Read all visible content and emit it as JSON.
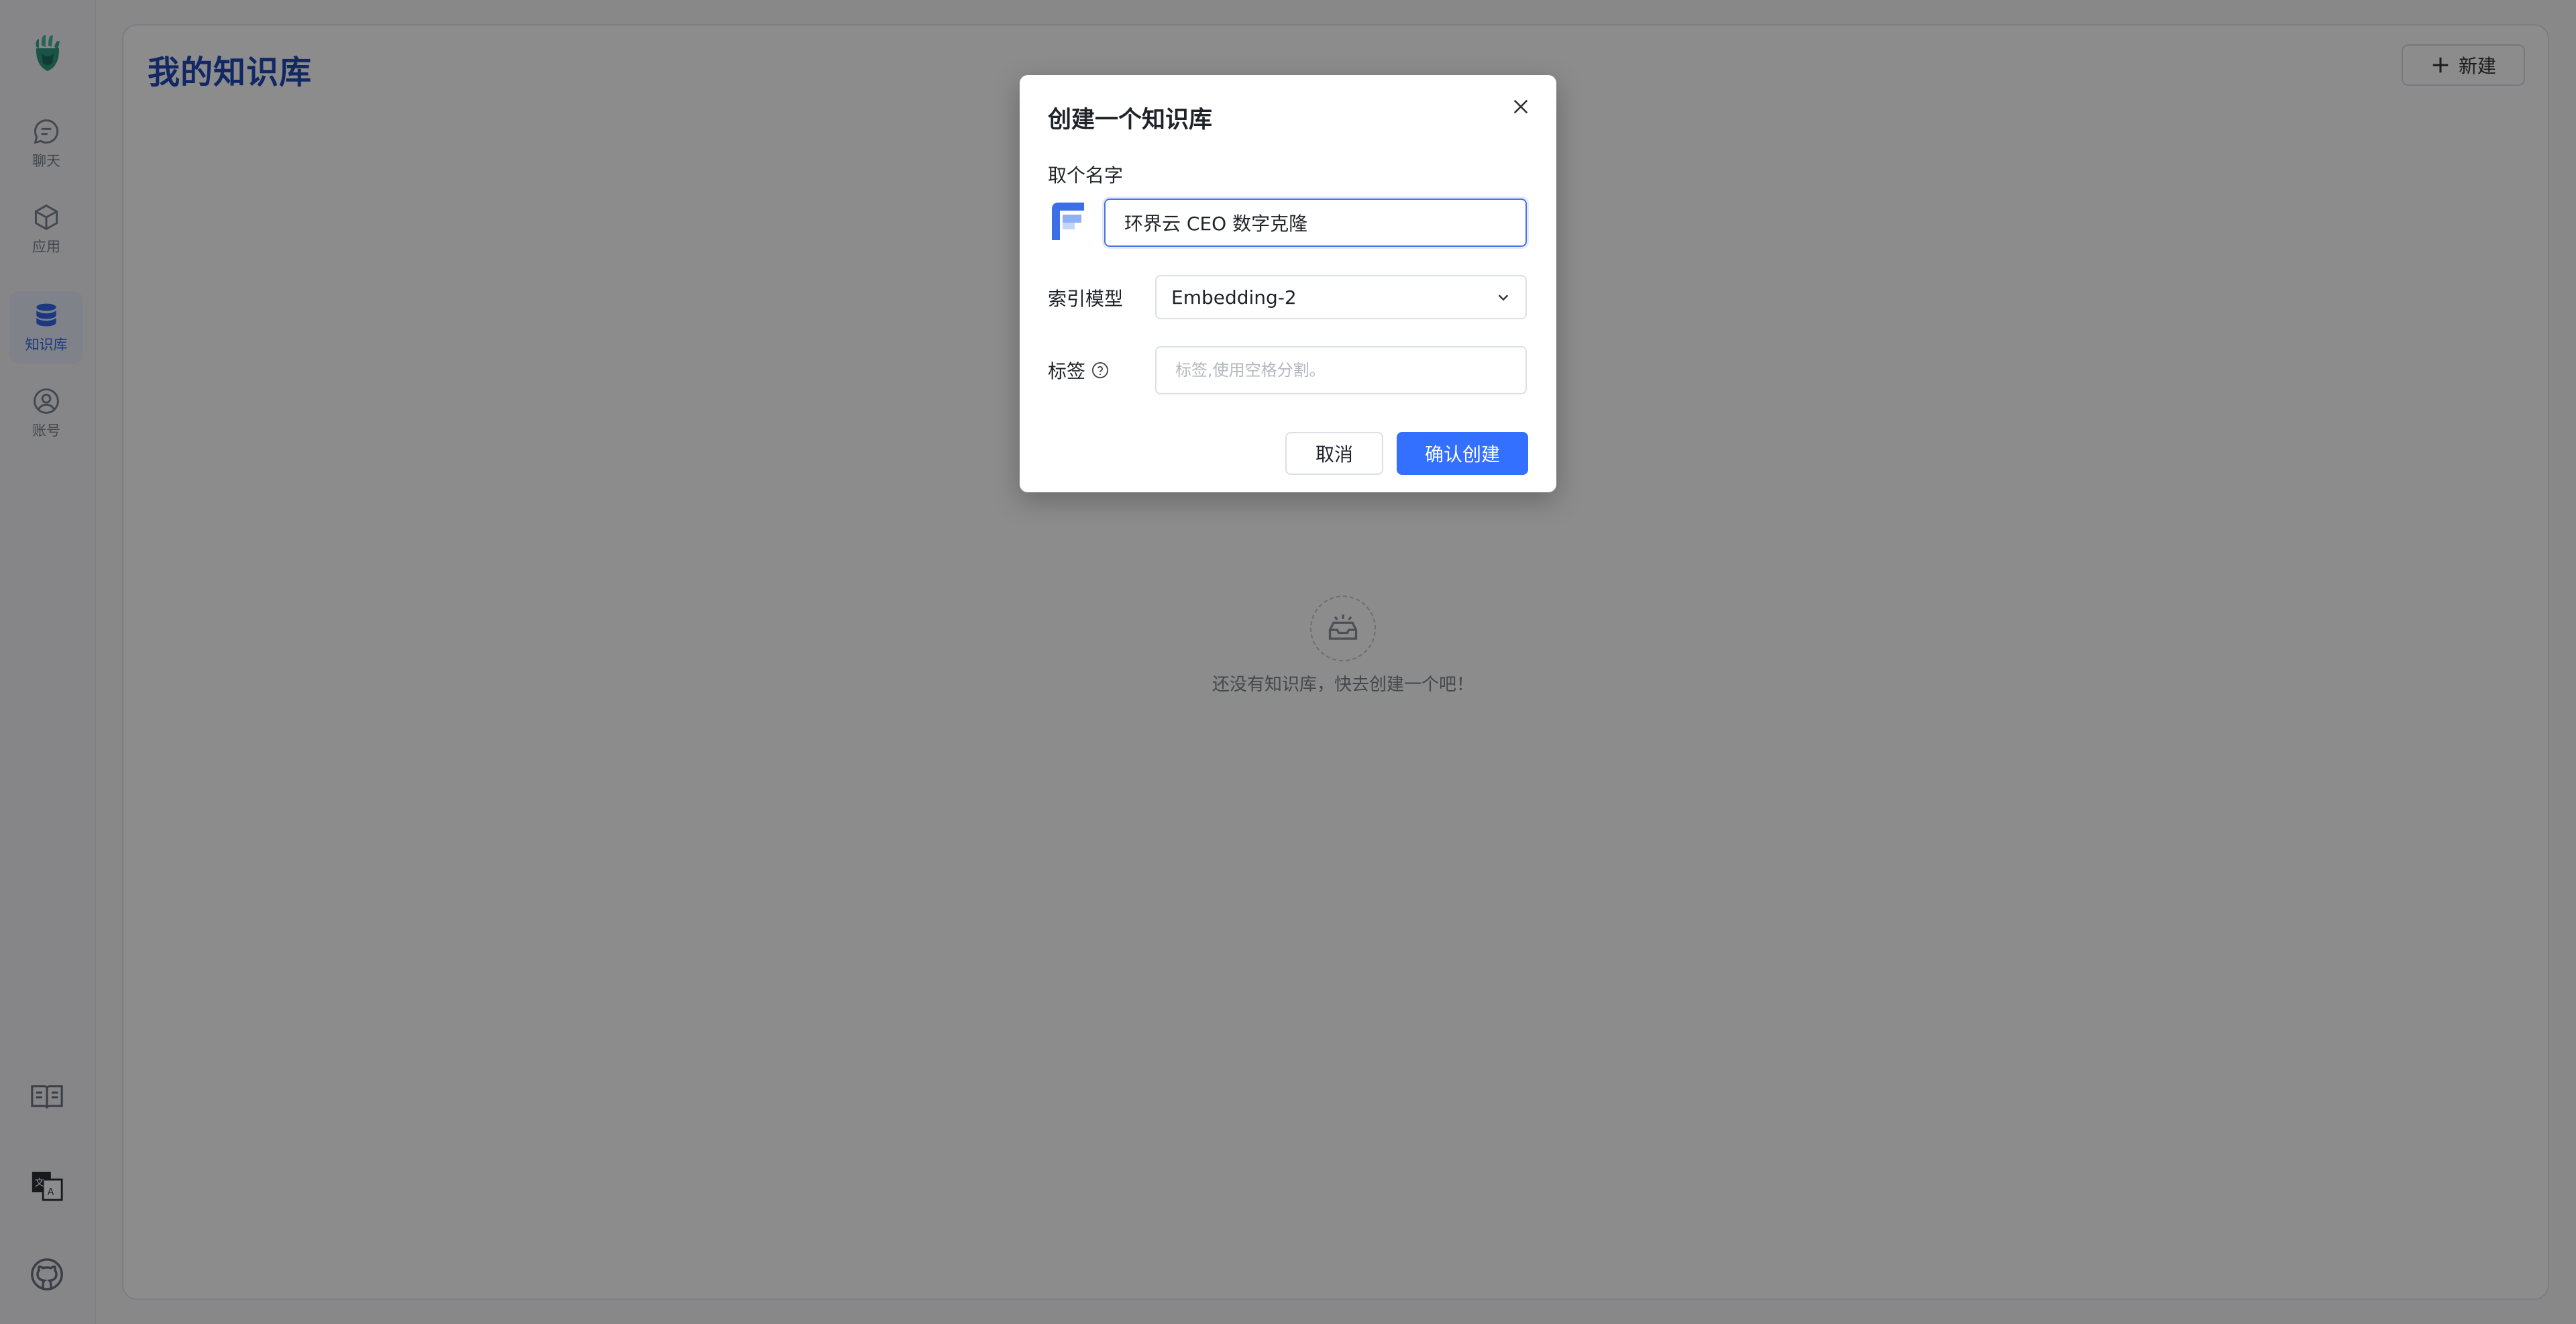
{
  "sidebar": {
    "items": [
      {
        "label": "聊天",
        "icon": "chat-icon",
        "active": false
      },
      {
        "label": "应用",
        "icon": "cube-icon",
        "active": false
      },
      {
        "label": "知识库",
        "icon": "database-icon",
        "active": true
      },
      {
        "label": "账号",
        "icon": "user-icon",
        "active": false
      }
    ],
    "tools": [
      {
        "icon": "book-icon"
      },
      {
        "icon": "translate-icon"
      },
      {
        "icon": "github-icon"
      }
    ]
  },
  "main": {
    "title": "我的知识库",
    "new_button_label": "新建",
    "empty_text": "还没有知识库，快去创建一个吧！"
  },
  "modal": {
    "title": "创建一个知识库",
    "name_label": "取个名字",
    "name_value": "环界云 CEO 数字克隆",
    "model_label": "索引模型",
    "model_value": "Embedding-2",
    "tag_label": "标签",
    "tag_placeholder": "标签,使用空格分割。",
    "cancel_label": "取消",
    "confirm_label": "确认创建"
  },
  "colors": {
    "accent": "#3370ff",
    "title_blue": "#1f49b6",
    "overlay": "rgba(0,0,0,0.45)"
  }
}
